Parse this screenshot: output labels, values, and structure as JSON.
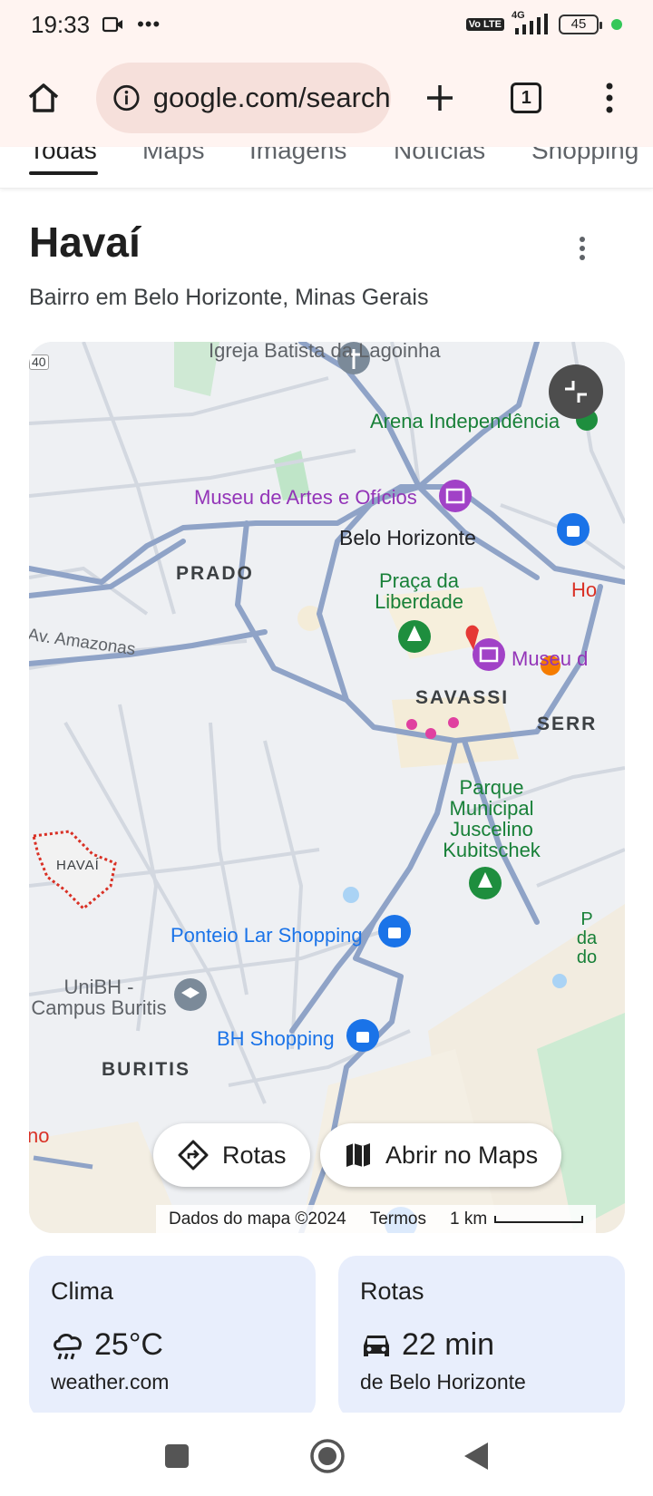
{
  "status_bar": {
    "time": "19:33",
    "network": "4G",
    "volte": "Vo LTE",
    "battery": "45"
  },
  "browser": {
    "url": "google.com/search",
    "tab_count": "1"
  },
  "search_tabs": [
    "Todas",
    "Maps",
    "Imagens",
    "Notícias",
    "Shopping"
  ],
  "knowledge_panel": {
    "title": "Havaí",
    "subtitle": "Bairro em Belo Horizonte, Minas Gerais"
  },
  "map": {
    "labels": {
      "church": "Igreja Batista da Lagoinha",
      "arena": "Arena Independência",
      "museum_arts": "Museu de Artes e Ofícios",
      "city": "Belo Horizonte",
      "prado": "PRADO",
      "praca": "Praça da Liberdade",
      "amazonas": "Av. Amazonas",
      "savassi": "SAVASSI",
      "museu_d": "Museu d",
      "serra": "SERR",
      "parque": "Parque Municipal Juscelino Kubitschek",
      "havai": "HAVAÍ",
      "ponteio": "Ponteio Lar Shopping",
      "unibh": "UniBH - Campus Buritis",
      "bh_shopping": "BH Shopping",
      "buritis": "BURITIS",
      "road_40": "40",
      "ho": "Ho",
      "pda": "P da do",
      "no": "no"
    },
    "buttons": {
      "directions": "Rotas",
      "open_maps": "Abrir no Maps"
    },
    "attribution": {
      "data": "Dados do mapa ©2024",
      "terms": "Termos",
      "scale": "1 km"
    }
  },
  "cards": {
    "weather": {
      "title": "Clima",
      "value": "25°C",
      "source": "weather.com"
    },
    "routes": {
      "title": "Rotas",
      "value": "22 min",
      "source": "de Belo Horizonte"
    }
  },
  "colors": {
    "browser_bg": "#fff4f1",
    "omnibox_bg": "#f6e0db",
    "card_bg": "#e8eefc",
    "road": "#8fa3c7",
    "poi_purple": "#9334b8",
    "poi_green": "#188038",
    "poi_blue": "#1a73e8"
  },
  "icons": [
    "video-icon",
    "more-icon",
    "signal-icon",
    "home-icon",
    "info-icon",
    "plus-icon",
    "tab-switcher-icon",
    "menu-dots-icon",
    "collapse-icon",
    "directions-icon",
    "map-icon",
    "weather-rain-icon",
    "car-icon",
    "recents-icon",
    "home-nav-icon",
    "back-icon"
  ]
}
